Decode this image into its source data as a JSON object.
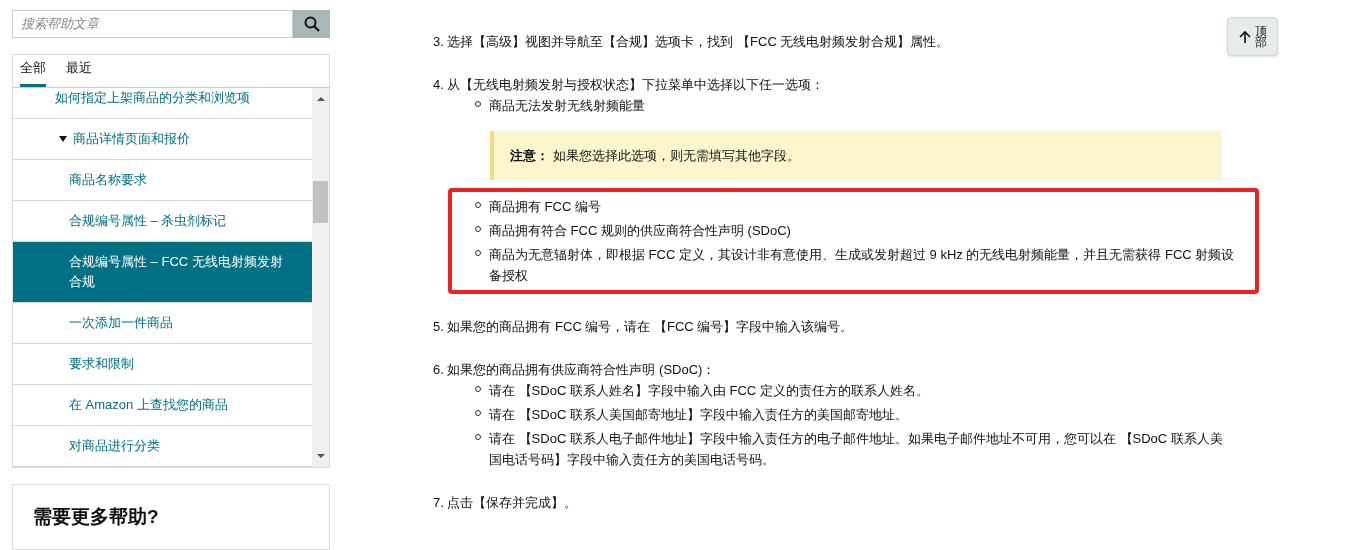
{
  "search": {
    "placeholder": "搜索帮助文章"
  },
  "tabs": [
    {
      "label": "全部",
      "selected": true
    },
    {
      "label": "最近",
      "selected": false
    }
  ],
  "tree": [
    {
      "label": "如何指定上架商品的分类和浏览项",
      "selected": false
    },
    {
      "label": "商品详情页面和报价",
      "expanded": true,
      "selected": false,
      "children": [
        {
          "label": "商品名称要求",
          "selected": false
        },
        {
          "label": "合规编号属性 – 杀虫剂标记",
          "selected": false
        },
        {
          "label": "合规编号属性 – FCC 无线电射频发射合规",
          "selected": true
        },
        {
          "label": "一次添加一件商品",
          "selected": false
        },
        {
          "label": "要求和限制",
          "selected": false
        },
        {
          "label": "在 Amazon 上查找您的商品",
          "selected": false
        },
        {
          "label": "对商品进行分类",
          "selected": false
        }
      ]
    }
  ],
  "help_card": {
    "title": "需要更多帮助?"
  },
  "back_to_top": {
    "label": "顶部"
  },
  "steps": [
    {
      "text": "3. 选择【高级】视图并导航至【合规】选项卡，找到 【FCC 无线电射频发射合规】属性。"
    },
    {
      "text": "4. 从【无线电射频发射与授权状态】下拉菜单中选择以下任一选项：",
      "bullets": [
        "商品无法发射无线射频能量"
      ],
      "note": {
        "label": "注意：",
        "text": "如果您选择此选项，则无需填写其他字段。"
      },
      "highlighted_bullets": [
        "商品拥有 FCC 编号",
        "商品拥有符合 FCC 规则的供应商符合性声明 (SDoC)",
        "商品为无意辐射体，即根据 FCC 定义，其设计非有意使用、生成或发射超过 9 kHz 的无线电射频能量，并且无需获得 FCC 射频设备授权"
      ]
    },
    {
      "text": "5. 如果您的商品拥有 FCC 编号，请在 【FCC 编号】字段中输入该编号。"
    },
    {
      "text": "6. 如果您的商品拥有供应商符合性声明 (SDoC)：",
      "bullets": [
        "请在 【SDoC 联系人姓名】字段中输入由 FCC 定义的责任方的联系人姓名。",
        "请在 【SDoC 联系人美国邮寄地址】字段中输入责任方的美国邮寄地址。",
        "请在 【SDoC 联系人电子邮件地址】字段中输入责任方的电子邮件地址。如果电子邮件地址不可用，您可以在 【SDoC 联系人美国电话号码】字段中输入责任方的美国电话号码。"
      ]
    },
    {
      "text": "7. 点击【保存并完成】。"
    }
  ]
}
